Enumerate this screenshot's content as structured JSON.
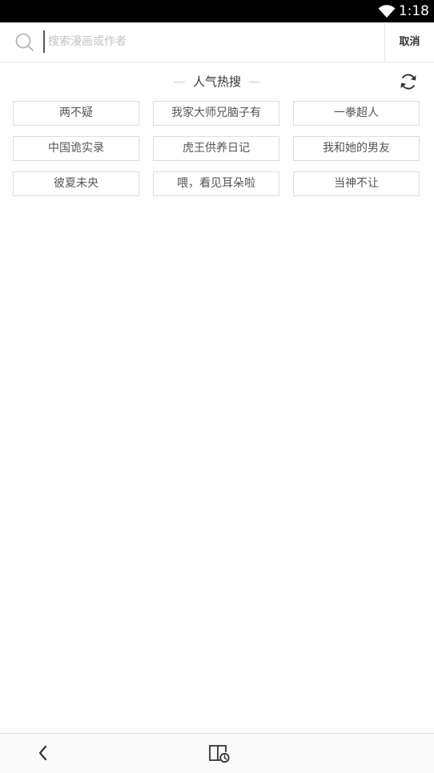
{
  "status_bar": {
    "time": "1:18",
    "wifi_icon": "wifi-icon"
  },
  "search": {
    "placeholder": "搜索漫画或作者",
    "value": "",
    "search_icon": "search-icon",
    "cancel_label": "取消"
  },
  "hot_search": {
    "title": "人气热搜",
    "refresh_icon": "refresh-icon",
    "tags": [
      "两不疑",
      "我家大师兄脑子有",
      "一拳超人",
      "中国诡实录",
      "虎王供养日记",
      "我和她的男友",
      "彼夏未央",
      "喂，看见耳朵啦",
      "当神不让"
    ]
  },
  "bottom_nav": {
    "back_icon": "chevron-left-icon",
    "history_icon": "reading-history-icon"
  },
  "colors": {
    "status_bar_bg": "#000000",
    "tag_border": "#dddddd",
    "tag_text": "#555555",
    "placeholder": "#c4c4c4"
  }
}
